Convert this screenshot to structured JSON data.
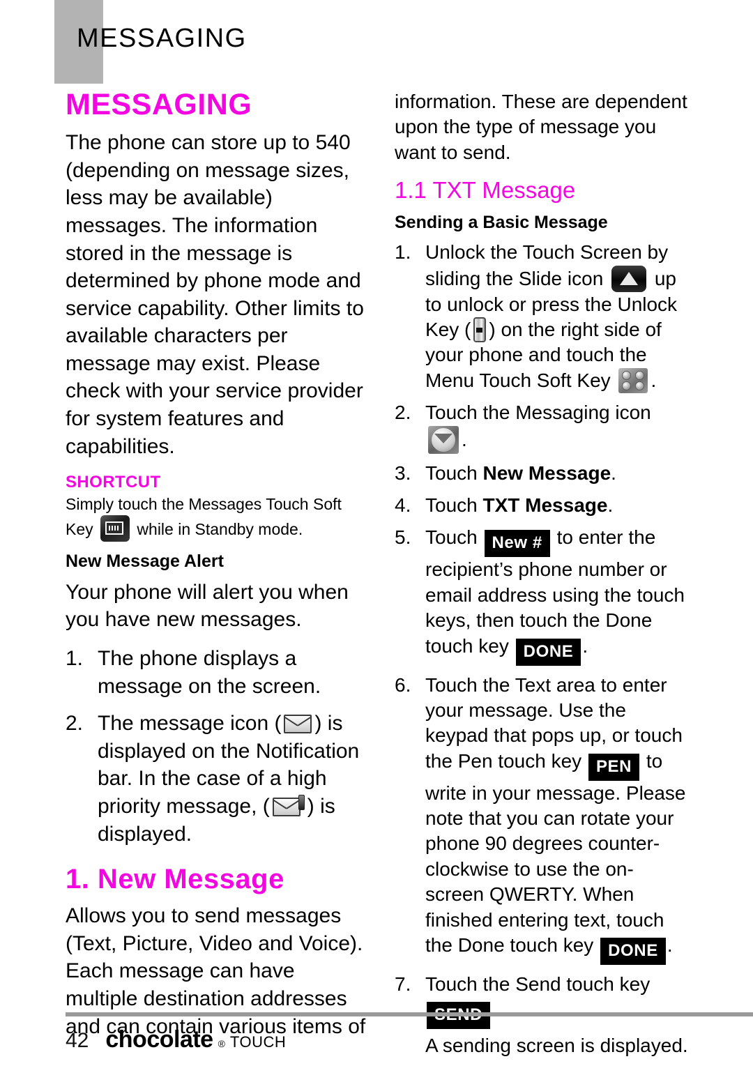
{
  "header": {
    "running_title": "MESSAGING"
  },
  "left_column": {
    "h1_title": "MESSAGING",
    "intro_paragraph": "The phone can store up to 540 (depending on message sizes, less may be available) messages. The information stored in the message is determined by phone mode and service capability. Other limits to available characters per message may exist. Please check with your service provider for system features and capabilities.",
    "shortcut": {
      "label": "SHORTCUT",
      "text_before_icon": "Simply touch the Messages Touch Soft Key",
      "icon": "messages-soft-key-icon",
      "text_after_icon": "while in Standby mode."
    },
    "alert_heading": "New Message Alert",
    "alert_paragraph": "Your phone will alert you when you have new messages.",
    "alert_steps": [
      {
        "num": "1.",
        "text": "The phone displays a message on the screen."
      },
      {
        "num": "2.",
        "part_a": "The message icon (",
        "icon_a": "envelope-icon",
        "part_b": ") is displayed on the Notification bar. In the case of a high priority message, (",
        "icon_b": "envelope-priority-icon",
        "part_c": ") is displayed."
      }
    ],
    "new_message_heading": "1. New Message",
    "new_message_paragraph": "Allows you to send messages (Text, Picture, Video and Voice). Each message can have multiple destination addresses and can contain various items of"
  },
  "right_column": {
    "continued_paragraph": "information. These are dependent upon the type of message you want to send.",
    "txt_message_heading": "1.1 TXT Message",
    "sending_heading": "Sending a Basic Message",
    "steps": [
      {
        "num": "1.",
        "p1": "Unlock the Touch Screen by sliding the Slide icon",
        "icon1": "slide-icon",
        "p2": "up to unlock or press the Unlock Key (",
        "icon2": "unlock-key-icon",
        "p3": ") on the right side of your phone and touch the Menu Touch Soft Key",
        "icon3": "menu-soft-key-icon",
        "p4": "."
      },
      {
        "num": "2.",
        "p1": "Touch the Messaging icon",
        "icon1": "messaging-app-icon",
        "p2": "."
      },
      {
        "num": "3.",
        "p1": "Touch ",
        "bold1": "New Message",
        "p2": "."
      },
      {
        "num": "4.",
        "p1": "Touch ",
        "bold1": "TXT Message",
        "p2": "."
      },
      {
        "num": "5.",
        "p1": "Touch",
        "chip1": "New #",
        "p2": "to enter the recipient’s phone number or email address using the touch keys, then touch the Done touch key",
        "chip2": "DONE",
        "p3": "."
      },
      {
        "num": "6.",
        "p1": "Touch the Text area to enter your message. Use the keypad that pops up, or touch the Pen touch key",
        "chip1": "PEN",
        "p2": "to write in your message.  Please note that you can rotate your phone 90 degrees counter-clockwise to use the on-screen QWERTY. When finished entering text, touch the Done touch key",
        "chip2": "DONE",
        "p3": "."
      },
      {
        "num": "7.",
        "p1": "Touch the Send touch key",
        "chip1": "SEND",
        "p2": ".",
        "p3": "A sending screen is displayed."
      }
    ]
  },
  "footer": {
    "page_number": "42",
    "brand": "chocolate",
    "brand_mark": "®",
    "brand_suffix": "TOUCH"
  },
  "colors": {
    "accent_magenta": "#f207e0",
    "header_tab_gray": "#b3b3b3",
    "footer_rule_gray": "#9a9a9a"
  }
}
